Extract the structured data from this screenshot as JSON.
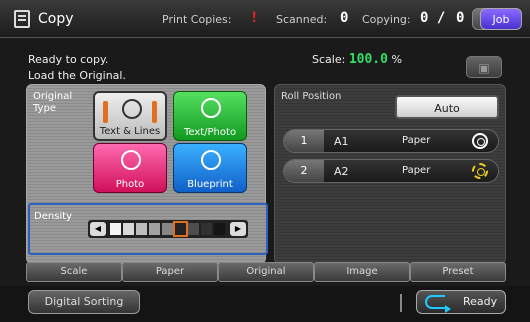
{
  "header": {
    "app_title": "Copy",
    "print_copies_label": "Print Copies:",
    "print_copies_value": "!",
    "scanned_label": "Scanned:",
    "scanned_value": "0",
    "copying_label": "Copying:",
    "copying_value": "0 /",
    "copying_total": "0",
    "job_label": "Job"
  },
  "status": {
    "line1": "Ready to copy.",
    "line2": "Load the Original.",
    "scale_label": "Scale:",
    "scale_value": "100.0",
    "scale_unit": "%"
  },
  "original_type": {
    "label_line1": "Original",
    "label_line2": "Type",
    "buttons": [
      {
        "label": "Text & Lines",
        "selected": true
      },
      {
        "label": "Text/Photo"
      },
      {
        "label": "Photo"
      },
      {
        "label": "Blueprint"
      }
    ]
  },
  "density": {
    "label": "Density",
    "levels": 9,
    "selected_level": 6
  },
  "roll_position": {
    "label": "Roll Position",
    "auto_label": "Auto",
    "rolls": [
      {
        "number": "1",
        "size": "A1",
        "type": "Paper",
        "icon": "roll-icon"
      },
      {
        "number": "2",
        "size": "A2",
        "type": "Paper",
        "icon": "roll-warning-icon"
      }
    ]
  },
  "tabs": [
    "Scale",
    "Paper",
    "Original",
    "Image",
    "Preset"
  ],
  "footer": {
    "digital_sorting_label": "Digital Sorting",
    "ready_label": "Ready"
  },
  "colors": {
    "accent_green": "#33dd66",
    "error_red": "#ff2020",
    "density_highlight": "#2a60c0"
  }
}
